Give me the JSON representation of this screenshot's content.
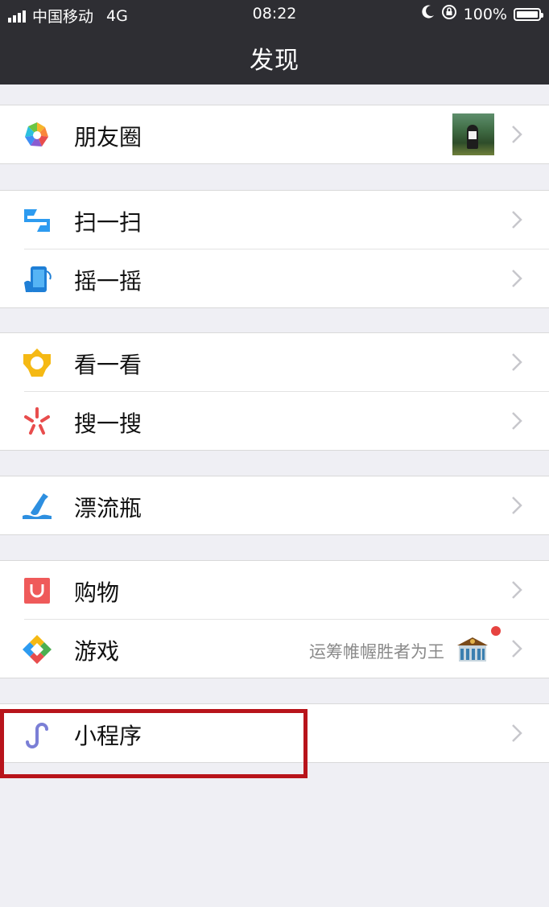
{
  "status_bar": {
    "carrier": "中国移动",
    "network": "4G",
    "time": "08:22",
    "battery": "100%"
  },
  "nav": {
    "title": "发现"
  },
  "groups": [
    {
      "items": [
        {
          "label": "朋友圈",
          "icon": "moments-aperture-icon"
        }
      ]
    },
    {
      "items": [
        {
          "label": "扫一扫",
          "icon": "scan-icon"
        },
        {
          "label": "摇一摇",
          "icon": "shake-icon"
        }
      ]
    },
    {
      "items": [
        {
          "label": "看一看",
          "icon": "top-stories-icon"
        },
        {
          "label": "搜一搜",
          "icon": "search-sparkle-icon"
        }
      ]
    },
    {
      "items": [
        {
          "label": "漂流瓶",
          "icon": "drift-bottle-icon"
        }
      ]
    },
    {
      "items": [
        {
          "label": "购物",
          "icon": "shopping-bag-icon"
        },
        {
          "label": "游戏",
          "icon": "games-diamond-icon",
          "subtext": "运筹帷幄胜者为王"
        }
      ]
    },
    {
      "items": [
        {
          "label": "小程序",
          "icon": "mini-program-icon"
        }
      ]
    }
  ],
  "colors": {
    "header": "#2e2e33",
    "background": "#efeff4",
    "highlight_border": "#b8141b",
    "badge_dot": "#e64340"
  }
}
